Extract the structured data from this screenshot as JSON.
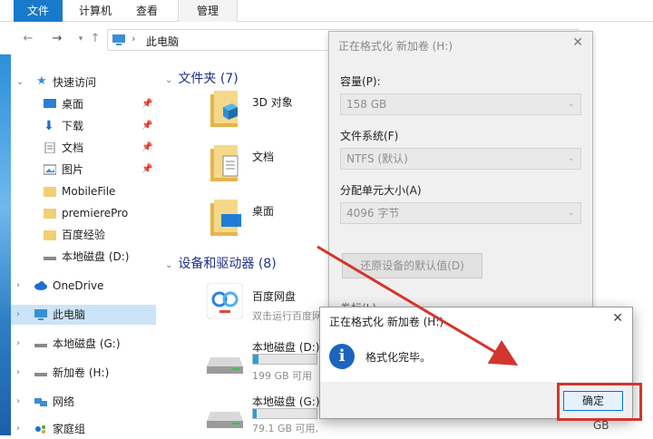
{
  "ribbon": {
    "tabs": [
      "文件",
      "计算机",
      "查看",
      "管理"
    ]
  },
  "address": {
    "crumb": "此电脑"
  },
  "sidebar": {
    "items": [
      {
        "label": "快速访问",
        "pinned": false
      },
      {
        "label": "桌面",
        "pinned": true
      },
      {
        "label": "下载",
        "pinned": true
      },
      {
        "label": "文档",
        "pinned": true
      },
      {
        "label": "图片",
        "pinned": true
      },
      {
        "label": "MobileFile",
        "pinned": false
      },
      {
        "label": "premierePro",
        "pinned": false
      },
      {
        "label": "百度经验",
        "pinned": false
      },
      {
        "label": "本地磁盘 (D:)",
        "pinned": false
      },
      {
        "label": "OneDrive",
        "pinned": false
      },
      {
        "label": "此电脑",
        "pinned": false
      },
      {
        "label": "本地磁盘 (G:)",
        "pinned": false
      },
      {
        "label": "新加卷 (H:)",
        "pinned": false
      },
      {
        "label": "网络",
        "pinned": false
      },
      {
        "label": "家庭组",
        "pinned": false
      }
    ]
  },
  "content": {
    "folders_header": "文件夹 (7)",
    "folders": [
      "3D 对象",
      "文档",
      "桌面"
    ],
    "devices_header": "设备和驱动器 (8)",
    "devices": [
      {
        "name": "百度网盘",
        "sub": "双击运行百度网盘"
      },
      {
        "name": "本地磁盘 (D:)",
        "sub": "199 GB 可用",
        "used_fraction": 0.08
      },
      {
        "name": "本地磁盘 (G:)",
        "sub": "79.1 GB 可用,",
        "used_fraction": 0.05
      }
    ]
  },
  "format_dialog": {
    "title": "正在格式化 新加卷 (H:)",
    "capacity_label": "容量(P):",
    "capacity_value": "158 GB",
    "fs_label": "文件系统(F)",
    "fs_value": "NTFS (默认)",
    "unit_label": "分配单元大小(A)",
    "unit_value": "4096 字节",
    "restore_button": "还原设备的默认值(D)",
    "partial_label": "卷标(L)",
    "gb_peek": "GB"
  },
  "message_box": {
    "title": "正在格式化 新加卷 (H:)",
    "text": "格式化完毕。",
    "ok_label": "确定"
  },
  "colors": {
    "accent": "#1979ca",
    "highlight": "#d2362e",
    "selection": "#cce4f7"
  }
}
